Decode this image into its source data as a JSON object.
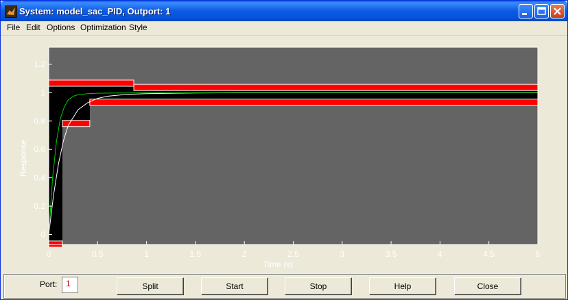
{
  "window": {
    "title": "System: model_sac_PID, Outport: 1"
  },
  "menu": [
    "File",
    "Edit",
    "Options",
    "Optimization",
    "Style"
  ],
  "chart_data": {
    "type": "line",
    "title": "",
    "xlabel": "Time (s)",
    "ylabel": "Response",
    "xlim": [
      0,
      5
    ],
    "ylim": [
      -0.07,
      1.32
    ],
    "x_ticks": [
      "0",
      "0.5",
      "1",
      "1.5",
      "2",
      "2.5",
      "3",
      "3.5",
      "4",
      "4.5",
      "5"
    ],
    "y_ticks": [
      "0",
      "0.2",
      "0.4",
      "0.6",
      "0.8",
      "1",
      "1.2"
    ],
    "colors": {
      "background": "#646464",
      "allowed_region": "#000000",
      "constraint": "#ff0000",
      "response_current": "#ffffff",
      "response_iteration": "#00cc00"
    },
    "constraints": {
      "upper_bound": [
        {
          "x": [
            0,
            0.87
          ],
          "y": 1.05
        },
        {
          "x": [
            0.87,
            5
          ],
          "y": 1.02
        }
      ],
      "lower_bound": [
        {
          "x": [
            0,
            0.14
          ],
          "y": -0.05
        },
        {
          "x": [
            0.14,
            0.42
          ],
          "y": 0.8
        },
        {
          "x": [
            0.42,
            5
          ],
          "y": 0.95
        }
      ]
    },
    "series": [
      {
        "x": [
          0,
          0.05,
          0.1,
          0.15,
          0.2,
          0.3,
          0.4,
          0.5,
          0.6,
          0.8,
          1.0,
          1.5,
          2.0,
          3.0,
          5.0
        ],
        "y": [
          0,
          0.28,
          0.5,
          0.66,
          0.77,
          0.88,
          0.93,
          0.96,
          0.975,
          0.988,
          0.993,
          0.998,
          1.0,
          1.0,
          1.0
        ]
      },
      {
        "x": [
          0,
          0.04,
          0.08,
          0.12,
          0.16,
          0.2,
          0.25,
          0.3,
          0.4,
          0.5,
          0.7,
          1.0,
          2.0,
          5.0
        ],
        "y": [
          0,
          0.4,
          0.66,
          0.82,
          0.9,
          0.95,
          0.975,
          0.985,
          0.993,
          0.996,
          0.998,
          0.999,
          1.0,
          1.0
        ]
      }
    ]
  },
  "bottom": {
    "port_label": "Port:",
    "port_value": "1",
    "buttons": {
      "split": "Split",
      "start": "Start",
      "stop": "Stop",
      "help": "Help",
      "close": "Close"
    }
  }
}
